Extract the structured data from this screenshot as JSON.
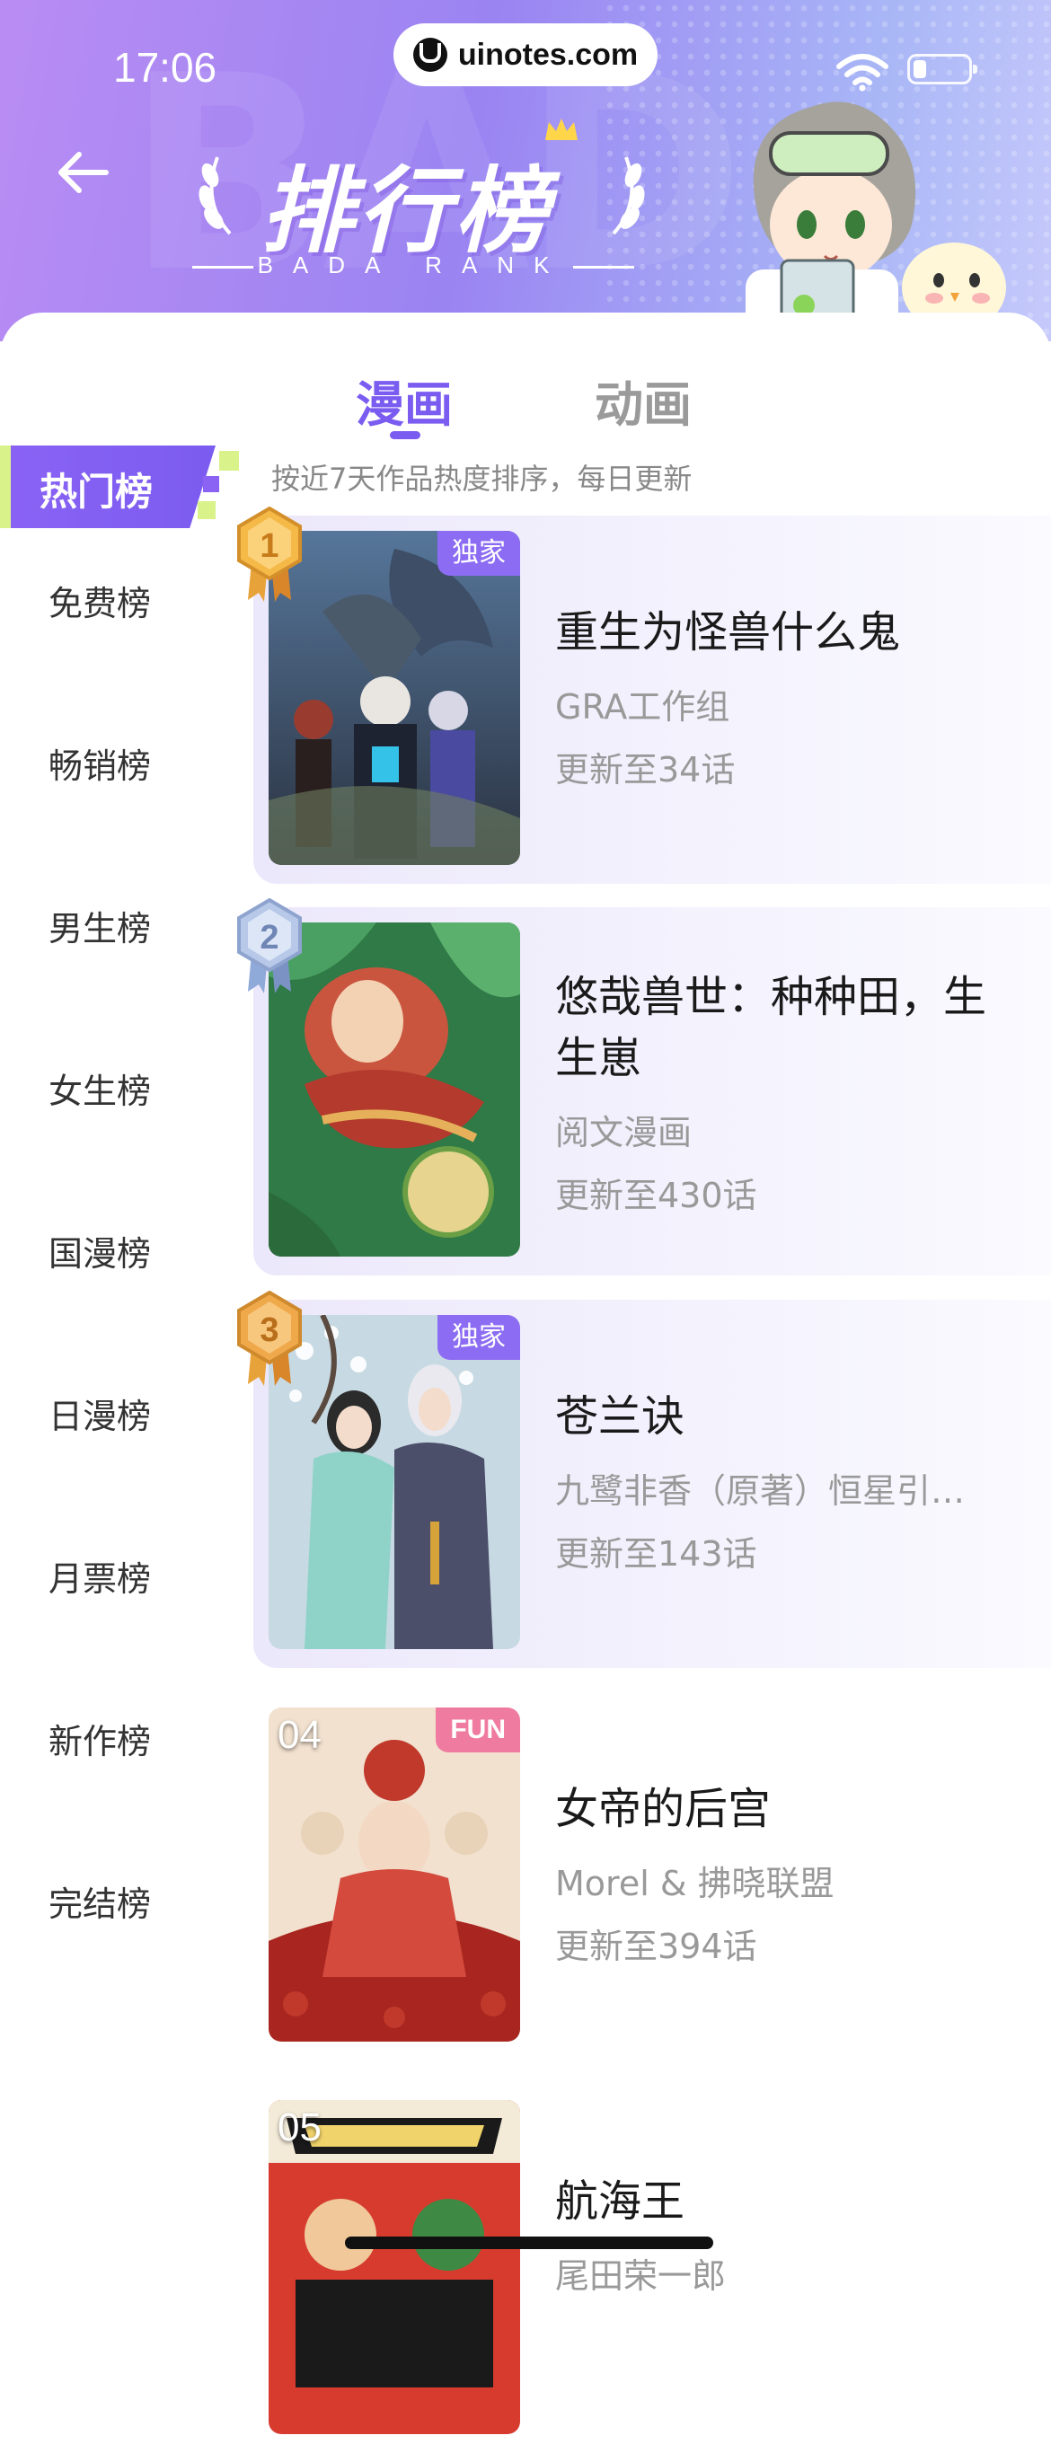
{
  "status_bar": {
    "time": "17:06",
    "url": "uinotes.com"
  },
  "header": {
    "title": "排行榜",
    "subtitle": "BADA RANK",
    "bg_word": "BAD"
  },
  "tabs": [
    {
      "label": "漫画",
      "active": true
    },
    {
      "label": "动画",
      "active": false
    }
  ],
  "sidebar": {
    "active": "热门榜",
    "items": [
      "免费榜",
      "畅销榜",
      "男生榜",
      "女生榜",
      "国漫榜",
      "日漫榜",
      "月票榜",
      "新作榜",
      "完结榜"
    ]
  },
  "list_subtitle": "按近7天作品热度排序，每日更新",
  "items": [
    {
      "rank": "1",
      "title": "重生为怪兽什么鬼",
      "author": "GRA工作组",
      "update": "更新至34话",
      "tag": "独家",
      "medal": "gold",
      "cover": [
        "#2c3a4f",
        "#6b8fb3",
        "#1d2330"
      ]
    },
    {
      "rank": "2",
      "title": "悠哉兽世：种种田，生生崽",
      "author": "阅文漫画",
      "update": "更新至430话",
      "tag": "",
      "medal": "silver",
      "cover": [
        "#1e6b3e",
        "#b5473a",
        "#e9c39a"
      ]
    },
    {
      "rank": "3",
      "title": "苍兰诀",
      "author": "九鹭非香（原著）恒星引…",
      "update": "更新至143话",
      "tag": "独家",
      "medal": "gold",
      "cover": [
        "#8fb7c9",
        "#4a6d8a",
        "#d8e6ee"
      ]
    },
    {
      "rank": "04",
      "title": "女帝的后宫",
      "author": "Morel & 拂晓联盟",
      "update": "更新至394话",
      "tag": "FUN",
      "medal": "",
      "cover": [
        "#b8322c",
        "#e8c2a8",
        "#6e1b1b"
      ]
    },
    {
      "rank": "05",
      "title": "航海王",
      "author": "尾田荣一郎",
      "update": "",
      "tag": "",
      "medal": "",
      "cover": [
        "#d63b2e",
        "#1a1a1a",
        "#f1d36b"
      ]
    }
  ],
  "colors": {
    "accent": "#7b5cf0",
    "gold": "#e8a23a",
    "silver": "#8fa9d8",
    "lime": "#d9f28a"
  }
}
